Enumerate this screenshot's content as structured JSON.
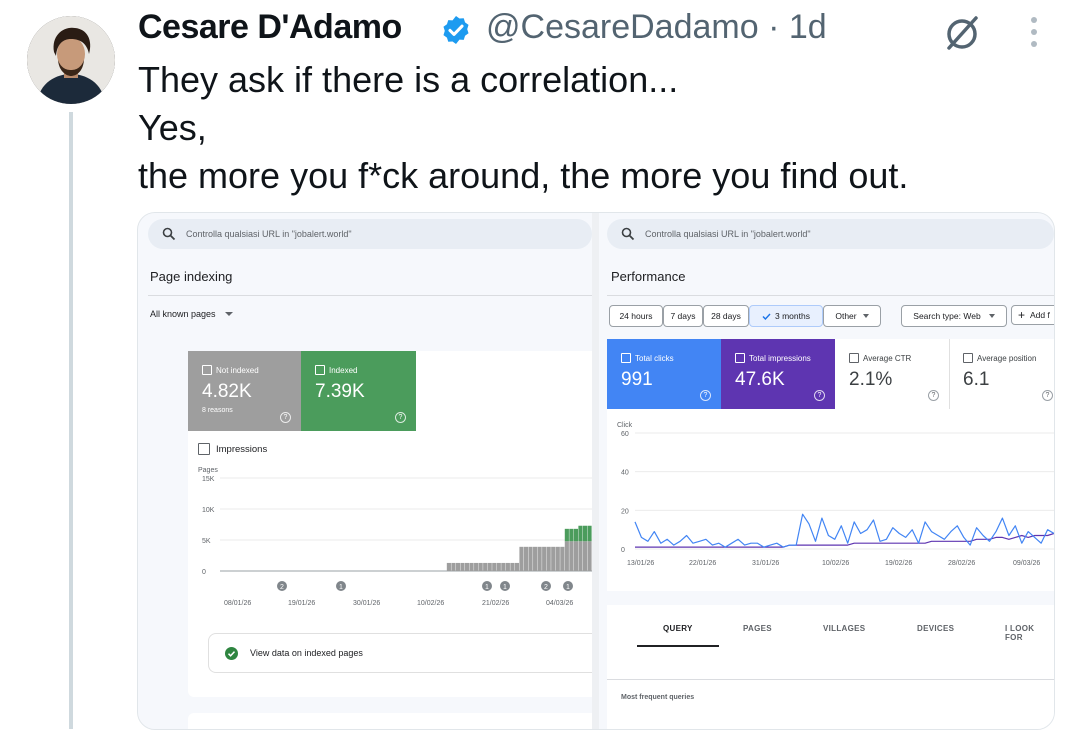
{
  "tweet": {
    "author_name": "Cesare D'Adamo",
    "handle": "@CesareDadamo",
    "separator": "·",
    "time": "1d",
    "lines": [
      "They ask if there is a correlation...",
      "Yes,",
      "the more you f*ck around, the more you find out."
    ]
  },
  "left_panel": {
    "search_placeholder": "Controlla qualsiasi URL in \"jobalert.world\"",
    "title": "Page indexing",
    "filter": "All known pages",
    "not_indexed": {
      "label": "Not indexed",
      "value": "4.82K",
      "sub": "8 reasons",
      "color": "#9e9e9e"
    },
    "indexed": {
      "label": "Indexed",
      "value": "7.39K",
      "color": "#4b9c5c"
    },
    "impressions_label": "Impressions",
    "y_title": "Pages",
    "y_ticks": [
      "15K",
      "10K",
      "5K",
      "0"
    ],
    "x_ticks": [
      "08/01/26",
      "19/01/26",
      "30/01/26",
      "10/02/26",
      "21/02/26",
      "04/03/26"
    ],
    "markers": [
      "2",
      "1",
      "1",
      "1",
      "2",
      "1"
    ],
    "view_data_label": "View data on indexed pages"
  },
  "right_panel": {
    "search_placeholder": "Controlla qualsiasi URL in \"jobalert.world\"",
    "title": "Performance",
    "date_chips": [
      "24 hours",
      "7 days",
      "28 days",
      "3 months",
      "Other"
    ],
    "search_type": "Search type: Web",
    "add_label": "Add f",
    "metrics": [
      {
        "label": "Total clicks",
        "value": "991",
        "color": "#4285f4"
      },
      {
        "label": "Total impressions",
        "value": "47.6K",
        "color": "#5e35b1"
      },
      {
        "label": "Average CTR",
        "value": "2.1%"
      },
      {
        "label": "Average position",
        "value": "6.1"
      }
    ],
    "y_title": "Click",
    "y_ticks": [
      "60",
      "40",
      "20",
      "0"
    ],
    "x_ticks": [
      "13/01/26",
      "22/01/26",
      "31/01/26",
      "10/02/26",
      "19/02/26",
      "28/02/26",
      "09/03/26"
    ],
    "tabs": [
      "QUERY",
      "PAGES",
      "VILLAGES",
      "DEVICES",
      "I LOOK FOR"
    ],
    "most_frequent": "Most frequent queries"
  },
  "chart_data": [
    {
      "type": "bar",
      "title": "Page indexing",
      "ylabel": "Pages",
      "ylim": [
        0,
        15000
      ],
      "x_ticks": [
        "08/01/26",
        "19/01/26",
        "30/01/26",
        "10/02/26",
        "21/02/26",
        "04/03/26"
      ],
      "series": [
        {
          "name": "Not indexed",
          "values": [
            0,
            0,
            0,
            0,
            0,
            0,
            0,
            0,
            0,
            0,
            0,
            0,
            0,
            0,
            0,
            0,
            0,
            0,
            0,
            0,
            0,
            0,
            0,
            0,
            0,
            0,
            0,
            0,
            0,
            0,
            0,
            0,
            0,
            0,
            0,
            0,
            0,
            0,
            0,
            0,
            0,
            0,
            0,
            0,
            0,
            0,
            0,
            0,
            0,
            0,
            1300,
            1300,
            1300,
            1300,
            1300,
            1300,
            1300,
            1300,
            1300,
            1300,
            1300,
            1300,
            1300,
            1300,
            1300,
            1300,
            3900,
            3900,
            3900,
            3900,
            3900,
            3900,
            3900,
            3900,
            3900,
            3900,
            4800,
            4800,
            4800,
            4800,
            4800,
            4800
          ]
        },
        {
          "name": "Indexed",
          "values": [
            0,
            0,
            0,
            0,
            0,
            0,
            0,
            0,
            0,
            0,
            0,
            0,
            0,
            0,
            0,
            0,
            0,
            0,
            0,
            0,
            0,
            0,
            0,
            0,
            0,
            0,
            0,
            0,
            0,
            0,
            0,
            0,
            0,
            0,
            0,
            0,
            0,
            0,
            0,
            0,
            0,
            0,
            0,
            0,
            0,
            0,
            0,
            0,
            0,
            0,
            0,
            0,
            0,
            0,
            0,
            0,
            0,
            0,
            0,
            0,
            0,
            0,
            0,
            0,
            0,
            0,
            0,
            0,
            0,
            0,
            0,
            0,
            0,
            0,
            0,
            0,
            2000,
            2000,
            2000,
            2500,
            2500,
            2500
          ]
        }
      ]
    },
    {
      "type": "line",
      "title": "Performance",
      "ylabel": "Click",
      "ylim": [
        0,
        60
      ],
      "x_ticks": [
        "13/01/26",
        "22/01/26",
        "31/01/26",
        "10/02/26",
        "19/02/26",
        "28/02/26",
        "09/03/26"
      ],
      "series": [
        {
          "name": "Total clicks",
          "values": [
            14,
            6,
            4,
            9,
            3,
            5,
            2,
            4,
            7,
            3,
            4,
            5,
            2,
            3,
            1,
            3,
            5,
            2,
            3,
            3,
            1,
            2,
            3,
            1,
            2,
            2,
            18,
            13,
            4,
            16,
            7,
            5,
            12,
            3,
            14,
            8,
            10,
            15,
            4,
            5,
            11,
            8,
            6,
            10,
            3,
            14,
            9,
            7,
            5,
            9,
            12,
            6,
            2,
            11,
            7,
            4,
            9,
            16,
            7,
            12,
            3,
            9,
            6,
            3,
            10,
            8
          ],
          "color": "#4285f4"
        },
        {
          "name": "Total impressions",
          "values": [
            1,
            1,
            1,
            1,
            1,
            1,
            1,
            1,
            1,
            1,
            1,
            1,
            1,
            1,
            1,
            1,
            1,
            1,
            1,
            1,
            1,
            1,
            1,
            1,
            2,
            2,
            2,
            2,
            2,
            2,
            2,
            2,
            2,
            2,
            3,
            3,
            3,
            3,
            3,
            3,
            3,
            3,
            3,
            3,
            3,
            3,
            4,
            4,
            4,
            4,
            4,
            4,
            4,
            5,
            5,
            5,
            6,
            6,
            5,
            6,
            7,
            6,
            7,
            7,
            7,
            8
          ],
          "color": "#5e35b1"
        }
      ]
    }
  ]
}
